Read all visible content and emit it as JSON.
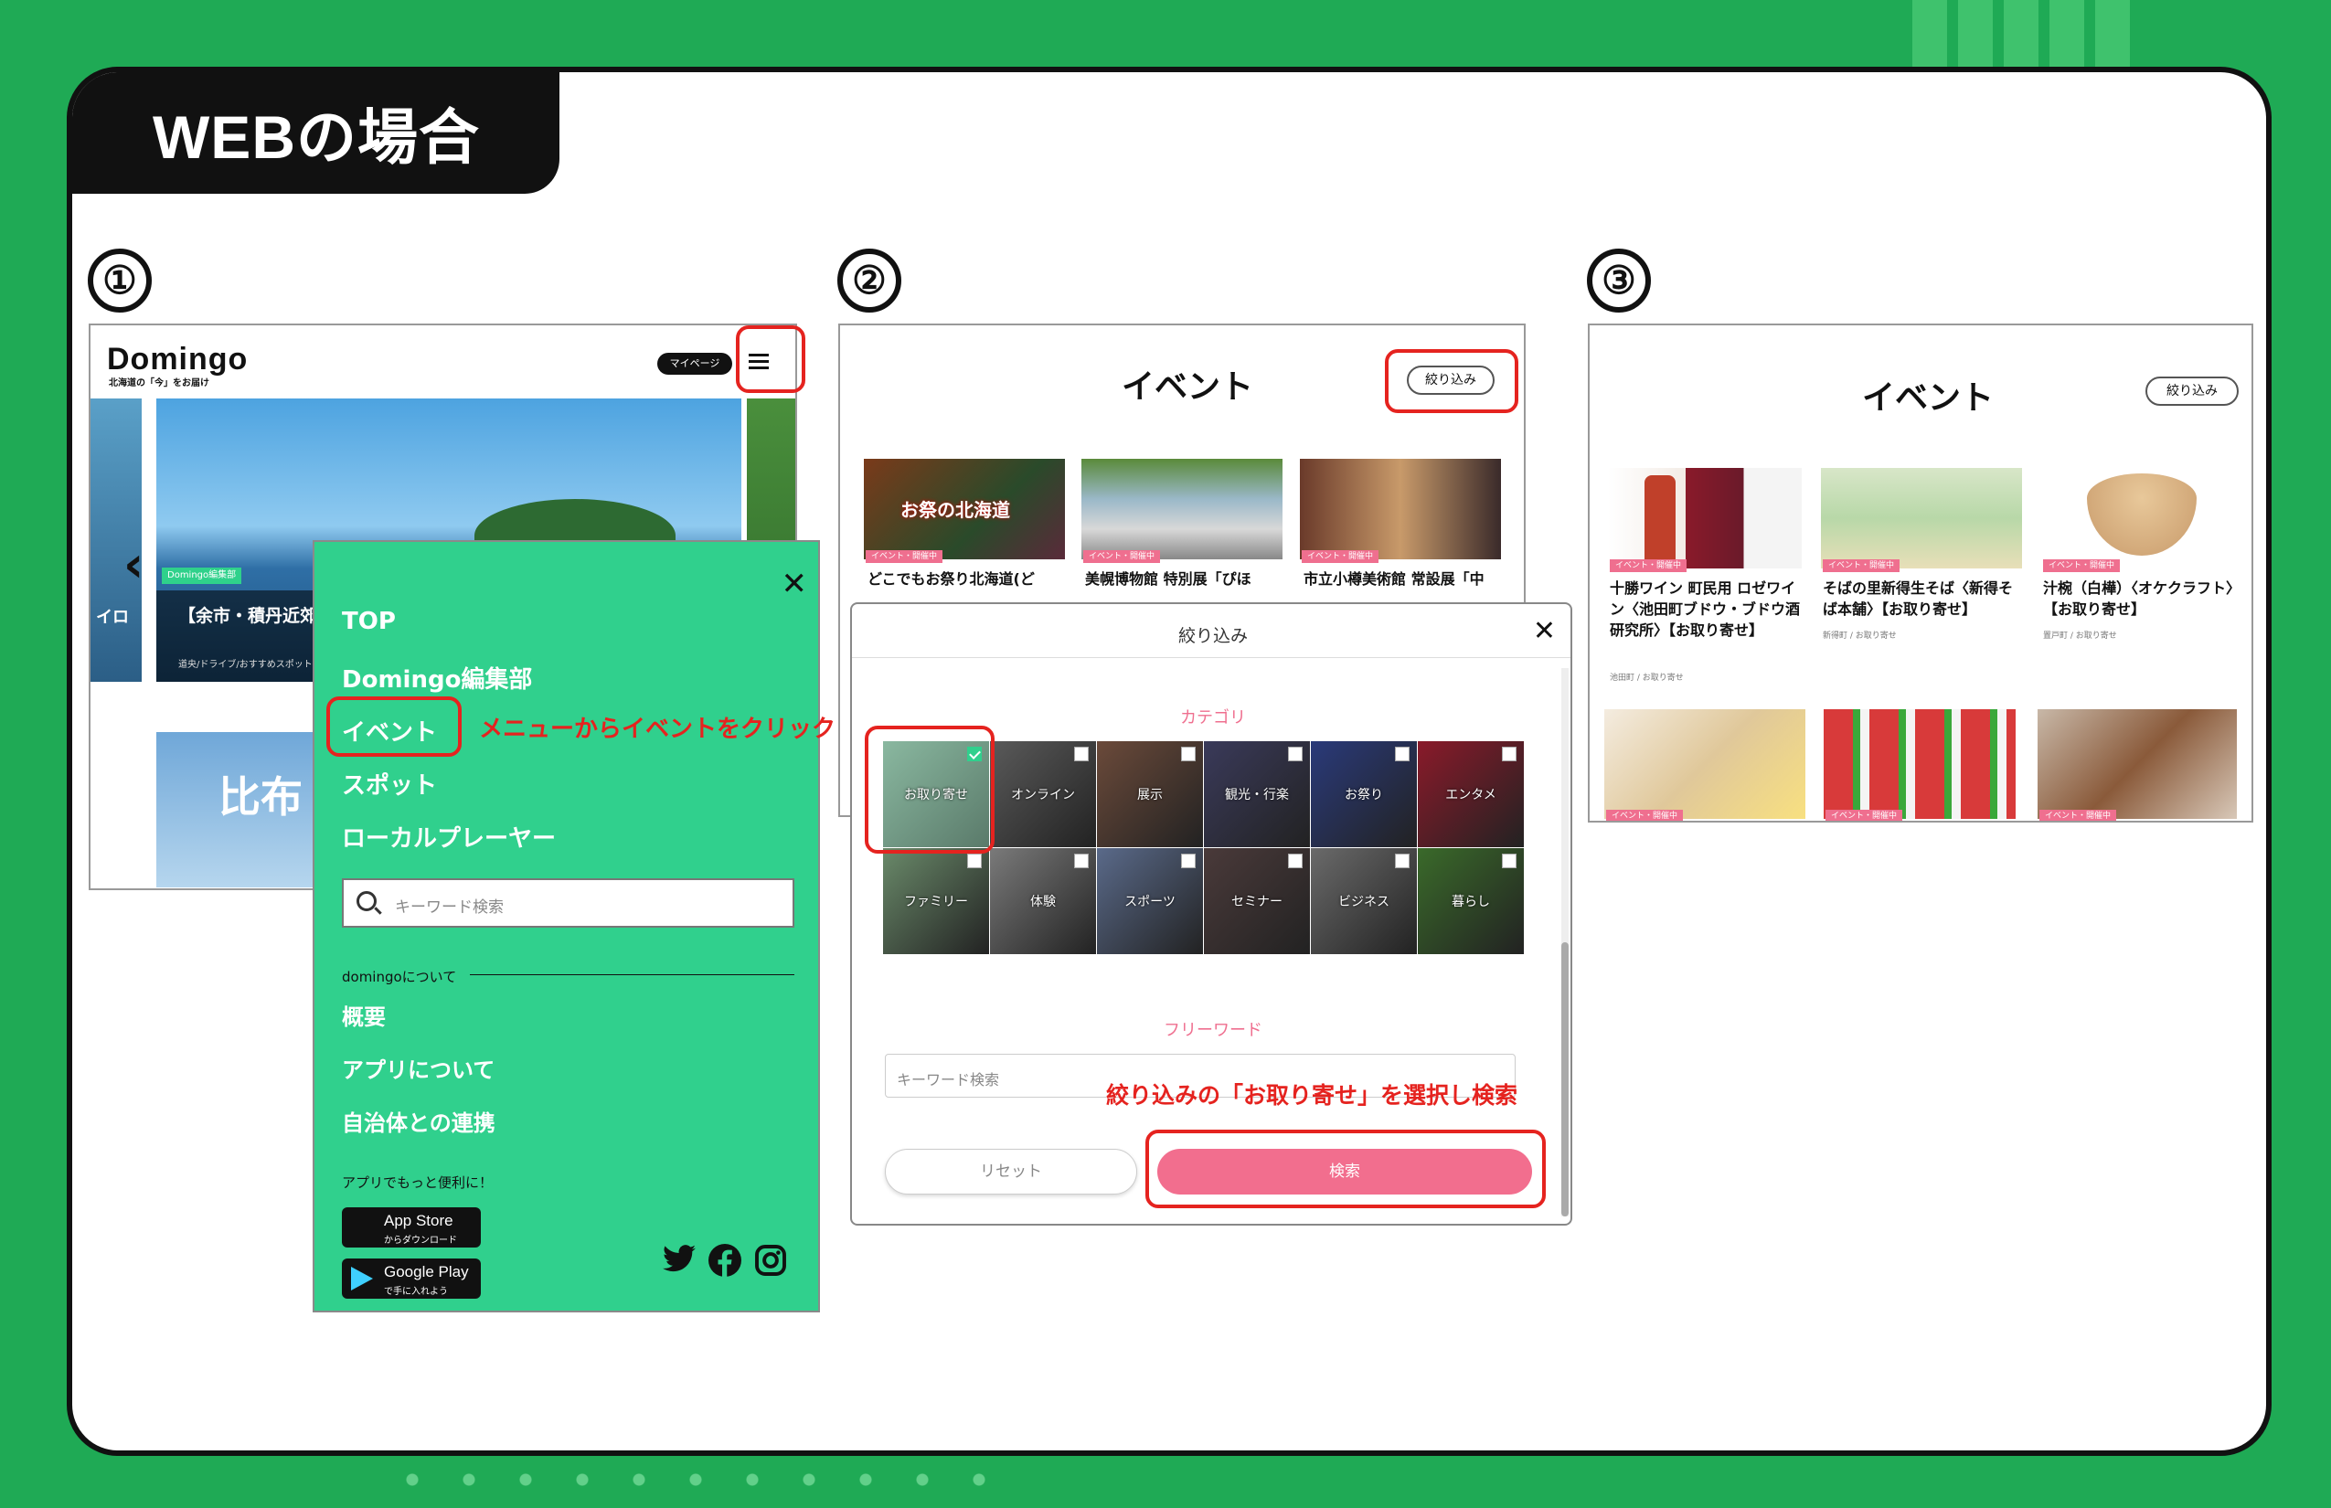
{
  "page": {
    "title": "WEBの場合",
    "steps": [
      "①",
      "②",
      "③"
    ]
  },
  "colors": {
    "background": "#1faa55",
    "menu_green": "#30d08d",
    "accent_pink": "#f26e8e",
    "annotation_red": "#e5231f"
  },
  "step1": {
    "logo": "Domingo",
    "logo_sub": "北海道の「今」をお届け",
    "mypage_label": "マイページ",
    "hamburger_icon": "hamburger-icon",
    "hero_badge": "Domingo編集部",
    "hero_caption": "【余市・積丹近郊 た海岸線を望む名",
    "hero_caption_small": "道央/ドライブ/おすすめスポット",
    "hero_left_text": "イロ",
    "bottom_text": "比布",
    "menu": {
      "items": [
        "TOP",
        "Domingo編集部",
        "イベント",
        "スポット",
        "ローカルプレーヤー"
      ],
      "search_placeholder": "キーワード検索",
      "section_label": "domingoについて",
      "sub_items": [
        "概要",
        "アプリについて",
        "自治体との連携"
      ],
      "app_label": "アプリでもっと便利に！",
      "appstore_title": "App Store",
      "appstore_sub": "からダウンロード",
      "googleplay_title": "Google Play",
      "googleplay_sub": "で手に入れよう"
    },
    "annotation": "メニューからイベントをクリック"
  },
  "step2": {
    "title": "イベント",
    "filter_label": "絞り込み",
    "cards": [
      {
        "badge": "イベント・開催中",
        "text": "どこでもお祭り北海道(ど"
      },
      {
        "badge": "イベント・開催中",
        "text": "美幌博物館 特別展「ぴほ"
      },
      {
        "badge": "イベント・開催中",
        "text": "市立小樽美術館 常設展「中"
      }
    ],
    "thumb_overlay_text": "お祭の北海道",
    "modal": {
      "title": "絞り込み",
      "category_heading": "カテゴリ",
      "categories": [
        {
          "label": "お取り寄せ",
          "checked": true,
          "color": "#7c9a8a"
        },
        {
          "label": "オンライン",
          "checked": false,
          "color": "#5a5a5a"
        },
        {
          "label": "展示",
          "checked": false,
          "color": "#6b4a3a"
        },
        {
          "label": "観光・行楽",
          "checked": false,
          "color": "#3a3a5a"
        },
        {
          "label": "お祭り",
          "checked": false,
          "color": "#2a3a7a"
        },
        {
          "label": "エンタメ",
          "checked": false,
          "color": "#8a1a2a"
        },
        {
          "label": "ファミリー",
          "checked": false,
          "color": "#6a8a6a"
        },
        {
          "label": "体験",
          "checked": false,
          "color": "#7a7a7a"
        },
        {
          "label": "スポーツ",
          "checked": false,
          "color": "#5a6a8a"
        },
        {
          "label": "セミナー",
          "checked": false,
          "color": "#4a3a3a"
        },
        {
          "label": "ビジネス",
          "checked": false,
          "color": "#6a6a6a"
        },
        {
          "label": "暮らし",
          "checked": false,
          "color": "#3a6a2a"
        }
      ],
      "freeword_heading": "フリーワード",
      "freeword_placeholder": "キーワード検索",
      "reset_label": "リセット",
      "search_label": "検索"
    },
    "annotation": "絞り込みの「お取り寄せ」を選択し検索"
  },
  "step3": {
    "title": "イベント",
    "filter_label": "絞り込み",
    "cards": [
      {
        "badge": "イベント・開催中",
        "text": "十勝ワイン 町民用 ロゼワイン〈池田町ブドウ・ブドウ酒研究所〉【お取り寄せ】",
        "small": "池田町 / お取り寄せ"
      },
      {
        "badge": "イベント・開催中",
        "text": "そばの里新得生そば〈新得そば本舗〉【お取り寄せ】",
        "small": "新得町 / お取り寄せ"
      },
      {
        "badge": "イベント・開催中",
        "text": "汁椀（白樺）〈オケクラフト〉【お取り寄せ】",
        "small": "置戸町 / お取り寄せ"
      }
    ],
    "bottom_badges": [
      "イベント・開催中",
      "イベント・開催中",
      "イベント・開催中"
    ]
  }
}
